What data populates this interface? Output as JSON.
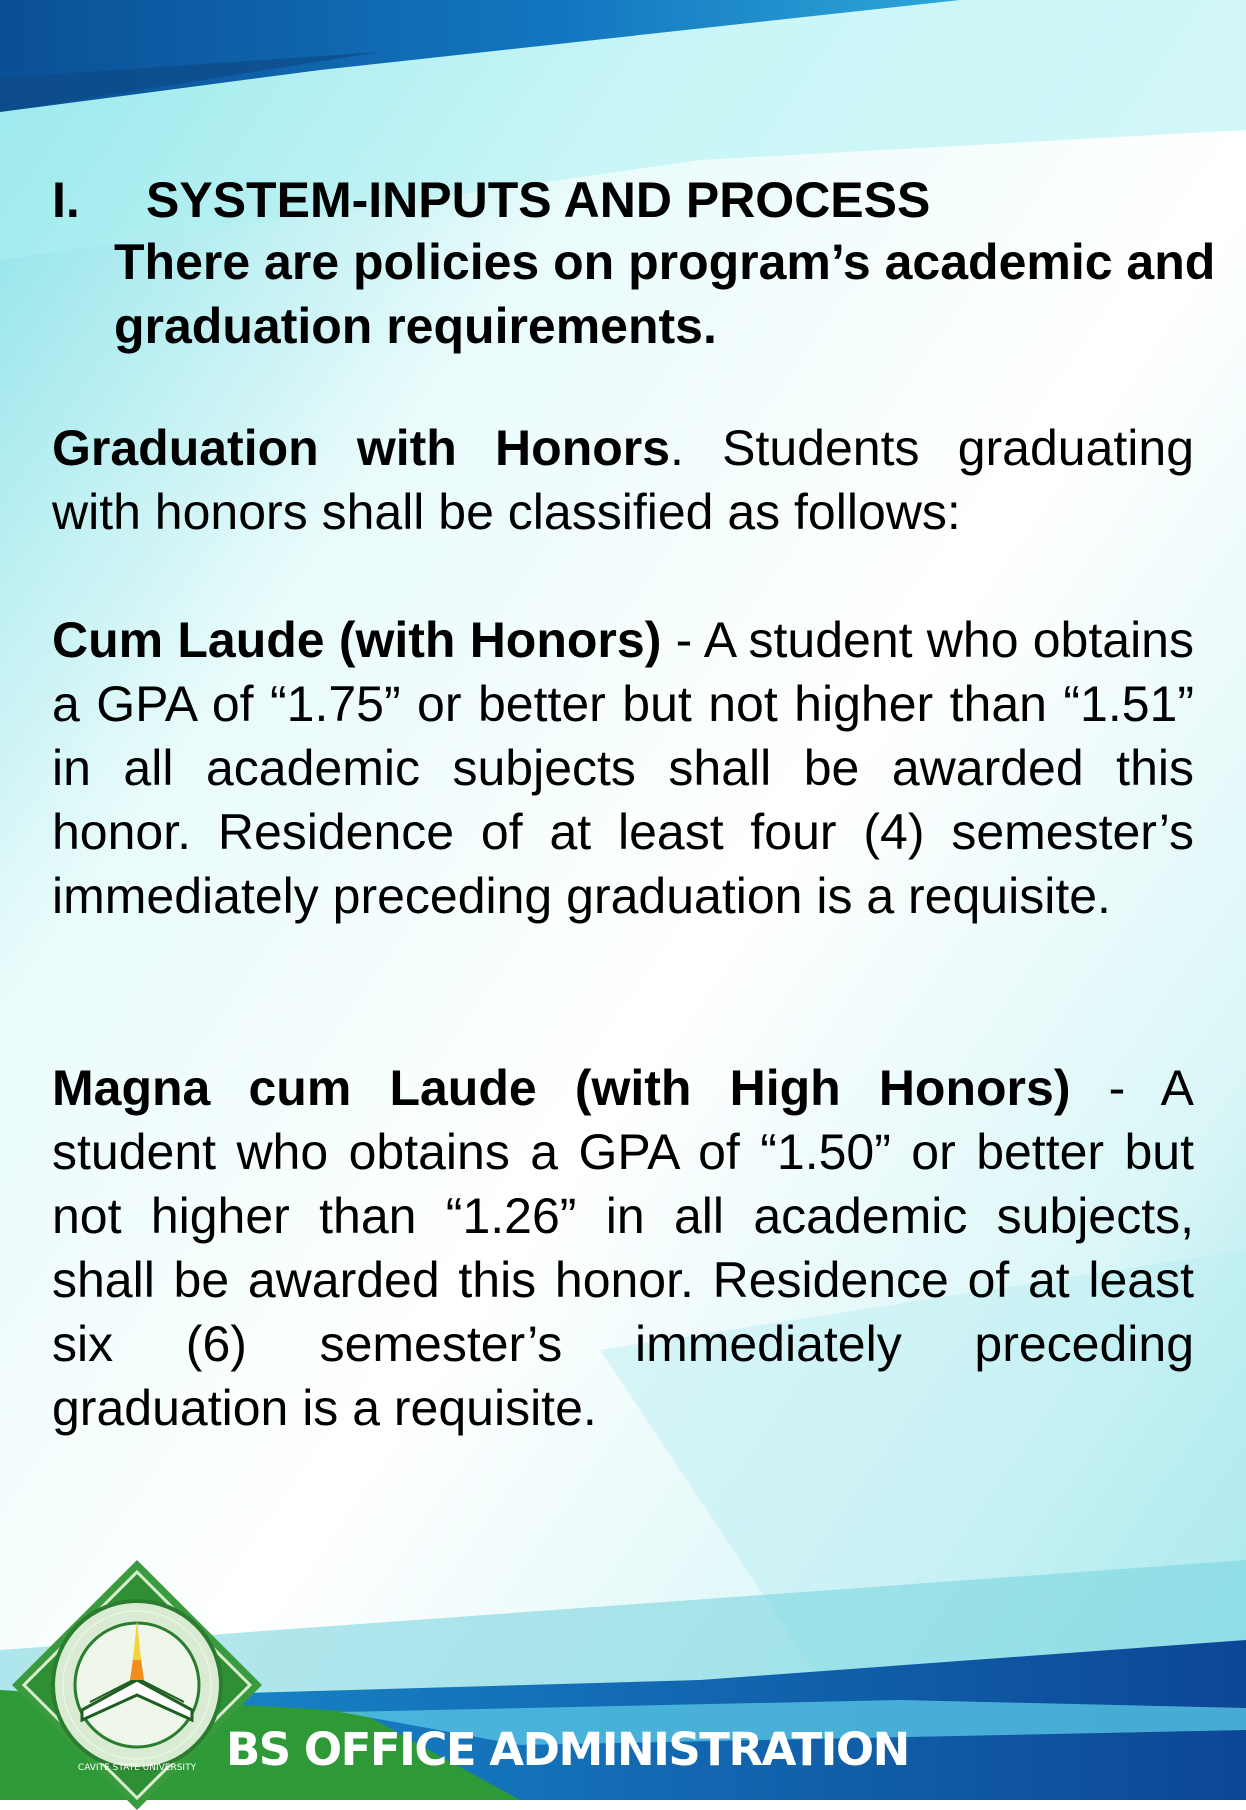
{
  "colors": {
    "top_band": "#0b5ea8",
    "background_light": "#e8fbfb",
    "background_cyan": "#8ae3ea",
    "footer_green": "#2f9a33",
    "footer_blue": "#0f4f9c",
    "logo_green": "#2f8f34"
  },
  "heading": {
    "number": "I.",
    "title": "SYSTEM-INPUTS AND PROCESS",
    "subtitle": "There are policies on program’s academic and graduation requirements."
  },
  "graduation_honors": {
    "term": "Graduation with Honors",
    "text": ". Students graduating with honors shall be classified as follows:"
  },
  "cum_laude": {
    "term": "Cum Laude (with Honors)",
    "text": " - A student who obtains a GPA of “1.75” or better but not higher than “1.51” in all academic subjects shall be awarded this honor. Residence of at least four (4) semester’s immediately preceding graduation is a requisite."
  },
  "magna_cum_laude": {
    "term": "Magna cum Laude (with High Honors)",
    "text": " - A student who obtains a GPA of “1.50” or better but not higher than “1.26” in all academic subjects, shall be awarded this honor. Residence of at least six (6) semester’s immediately preceding graduation is a requisite."
  },
  "footer": {
    "program": "BS OFFICE ADMINISTRATION",
    "logo_icon": "cavite-state-university-seal-icon",
    "logo_text": "CAVITE STATE UNIVERSITY"
  }
}
